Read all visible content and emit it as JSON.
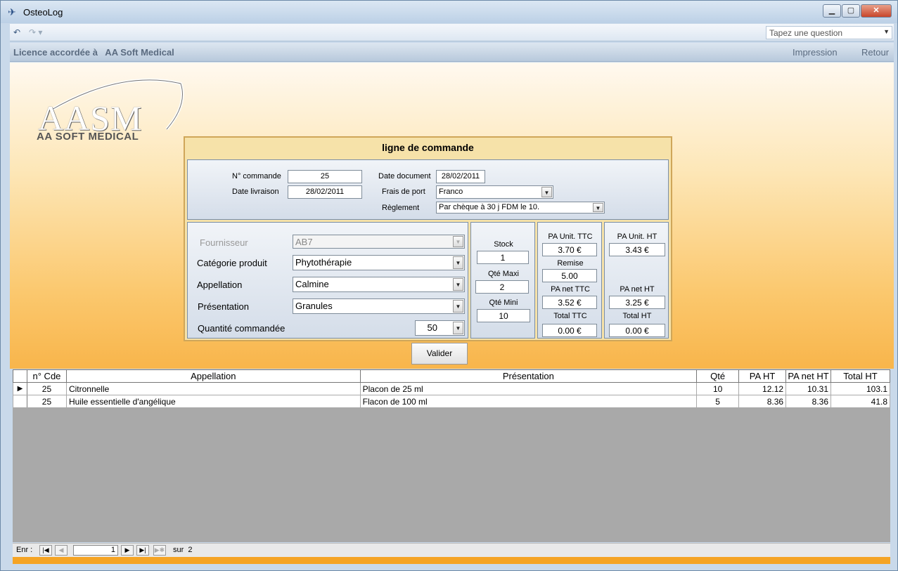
{
  "window": {
    "title": "OsteoLog"
  },
  "qat": {
    "ask_placeholder": "Tapez une question"
  },
  "licence": {
    "text": "Licence accordée à   AA Soft Medical",
    "print_link": "Impression",
    "back_link": "Retour"
  },
  "logo": {
    "main": "AASM",
    "sub": "AA SOFT MEDICAL"
  },
  "panel": {
    "title": "ligne de commande",
    "header": {
      "num_label": "N° commande",
      "num_value": "25",
      "date_doc_label": "Date document",
      "date_doc_value": "28/02/2011",
      "date_liv_label": "Date livraison",
      "date_liv_value": "28/02/2011",
      "frais_label": "Frais de port",
      "frais_value": "Franco",
      "reglement_label": "Règlement",
      "reglement_value": "Par chèque à 30 j FDM le 10."
    },
    "product": {
      "fournisseur_label": "Fournisseur",
      "fournisseur_value": "AB7",
      "categorie_label": "Catégorie produit",
      "categorie_value": "Phytothérapie",
      "appellation_label": "Appellation",
      "appellation_value": "Calmine",
      "presentation_label": "Présentation",
      "presentation_value": "Granules",
      "quantite_label": "Quantité commandée",
      "quantite_value": "50"
    },
    "stock": {
      "stock_label": "Stock",
      "stock_value": "1",
      "maxi_label": "Qté Maxi",
      "maxi_value": "2",
      "mini_label": "Qté Mini",
      "mini_value": "10"
    },
    "ttc": {
      "unit_label": "PA Unit. TTC",
      "unit_value": "3.70 €",
      "remise_label": "Remise",
      "remise_value": "5.00",
      "net_label": "PA net TTC",
      "net_value": "3.52 €",
      "total_label": "Total TTC",
      "total_value": "0.00 €"
    },
    "ht": {
      "unit_label": "PA Unit. HT",
      "unit_value": "3.43 €",
      "net_label": "PA net HT",
      "net_value": "3.25 €",
      "total_label": "Total HT",
      "total_value": "0.00 €"
    },
    "valider": "Valider"
  },
  "grid": {
    "headers": [
      "n° Cde",
      "Appellation",
      "Présentation",
      "Qté",
      "PA HT",
      "PA net HT",
      "Total HT"
    ],
    "rows": [
      [
        "25",
        "Citronnelle",
        "Placon de 25 ml",
        "10",
        "12.12",
        "10.31",
        "103.1"
      ],
      [
        "25",
        "Huile essentielle d'angélique",
        "Flacon de 100 ml",
        "5",
        "8.36",
        "8.36",
        "41.8"
      ]
    ]
  },
  "nav": {
    "label": "Enr :",
    "current": "1",
    "of_label": "sur",
    "total": "2"
  }
}
